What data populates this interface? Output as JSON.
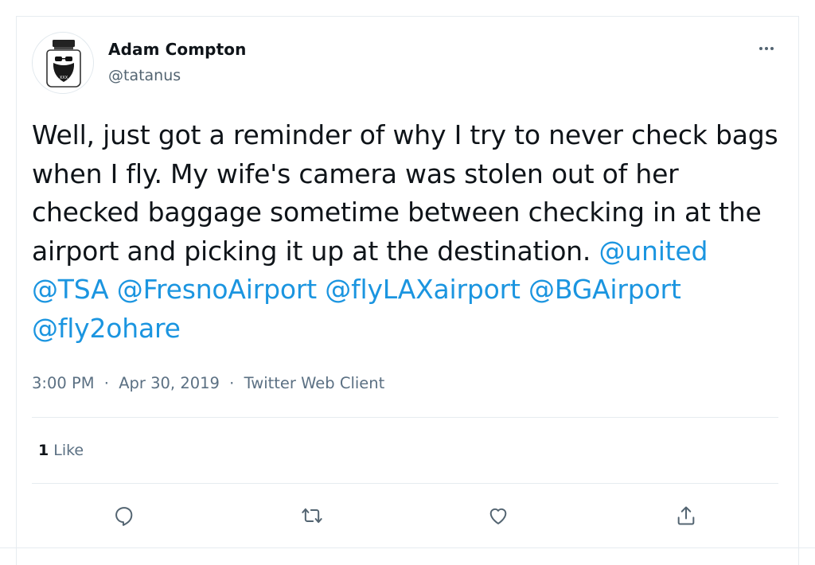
{
  "user": {
    "display_name": "Adam Compton",
    "handle": "@tatanus"
  },
  "tweet": {
    "segments": [
      {
        "text": "Well, just got a reminder of why I try to never check bags when I fly.  My wife's camera was stolen out of her checked baggage sometime between checking in at the airport and picking it up at the destination. ",
        "mention": false
      },
      {
        "text": "@united",
        "mention": true
      },
      {
        "text": " ",
        "mention": false
      },
      {
        "text": "@TSA",
        "mention": true
      },
      {
        "text": " ",
        "mention": false
      },
      {
        "text": "@FresnoAirport",
        "mention": true
      },
      {
        "text": " ",
        "mention": false
      },
      {
        "text": "@flyLAXairport",
        "mention": true
      },
      {
        "text": " ",
        "mention": false
      },
      {
        "text": "@BGAirport",
        "mention": true
      },
      {
        "text": " ",
        "mention": false
      },
      {
        "text": "@fly2ohare",
        "mention": true
      }
    ],
    "time": "3:00 PM",
    "date": "Apr 30, 2019",
    "client": "Twitter Web Client",
    "separator": "·"
  },
  "stats": {
    "likes_count": "1",
    "likes_label": "Like"
  },
  "actions": [
    {
      "name": "reply-icon"
    },
    {
      "name": "retweet-icon"
    },
    {
      "name": "like-icon"
    },
    {
      "name": "share-icon"
    }
  ],
  "colors": {
    "link": "#1b95e0",
    "muted": "#5b7083",
    "divider": "#e6ecf0"
  }
}
